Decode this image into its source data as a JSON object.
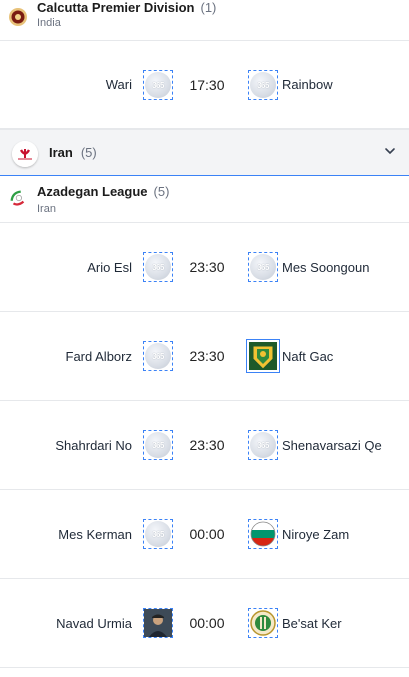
{
  "leagues_top": {
    "name": "Calcutta Premier Division",
    "count": "(1)",
    "country": "India",
    "matches": [
      {
        "home": "Wari",
        "time": "17:30",
        "away": "Rainbow"
      }
    ]
  },
  "country_section": {
    "name": "Iran",
    "count": "(5)",
    "chevron_icon": "chevron-down-icon"
  },
  "league_iran": {
    "name": "Azadegan League",
    "count": "(5)",
    "country": "Iran",
    "matches": [
      {
        "home": "Ario Esl",
        "time": "23:30",
        "away": "Mes Soongoun"
      },
      {
        "home": "Fard Alborz",
        "time": "23:30",
        "away": "Naft Gac"
      },
      {
        "home": "Shahrdari No",
        "time": "23:30",
        "away": "Shenavarsazi Qe"
      },
      {
        "home": "Mes Kerman",
        "time": "00:00",
        "away": "Niroye Zam"
      },
      {
        "home": "Navad Urmia",
        "time": "00:00",
        "away": "Be'sat Ker"
      }
    ]
  },
  "placeholder_logo_text": "365",
  "colors": {
    "accent": "#3b82f6",
    "divider": "#e6e8eb",
    "section_bg": "#f3f4f6"
  }
}
